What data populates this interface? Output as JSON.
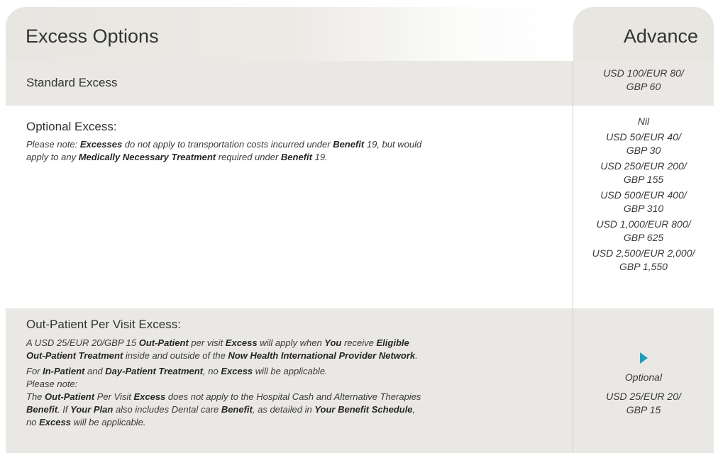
{
  "header": {
    "title": "Excess Options",
    "column_title": "Advance"
  },
  "standard_excess": {
    "label": "Standard Excess",
    "value_line1": "USD 100/EUR 80/",
    "value_line2": "GBP 60"
  },
  "optional_excess": {
    "label": "Optional Excess:",
    "note_line1": {
      "t1": "Please note: ",
      "b1": "Excesses",
      "t2": " do not apply to transportation costs incurred under ",
      "b2": "Benefit",
      "t3": " 19, but would"
    },
    "note_line2": {
      "t1": "apply to any ",
      "b1": "Medically Necessary Treatment",
      "t2": " required under ",
      "b2": "Benefit",
      "t3": " 19."
    },
    "options": [
      {
        "line1": "Nil",
        "line2": ""
      },
      {
        "line1": "USD 50/EUR 40/",
        "line2": "GBP 30"
      },
      {
        "line1": "USD 250/EUR 200/",
        "line2": "GBP 155"
      },
      {
        "line1": "USD 500/EUR 400/",
        "line2": "GBP 310"
      },
      {
        "line1": "USD 1,000/EUR 800/",
        "line2": "GBP 625"
      },
      {
        "line1": "USD 2,500/EUR 2,000/",
        "line2": "GBP 1,550"
      }
    ]
  },
  "outpatient_excess": {
    "label": "Out-Patient Per Visit Excess:",
    "p1_line1": {
      "t1": "A USD 25/EUR 20/GBP 15 ",
      "b1": "Out-Patient",
      "t2": " per visit ",
      "b2": "Excess",
      "t3": " will apply when ",
      "b3": "You",
      "t4": " receive ",
      "b4": "Eligible"
    },
    "p1_line2": {
      "b1": "Out-Patient Treatment",
      "t1": " inside and outside of the ",
      "b2": "Now Health International Provider Network",
      "t2": "."
    },
    "p2": {
      "t1": "For ",
      "b1": "In-Patient",
      "t2": " and ",
      "b2": "Day-Patient Treatment",
      "t3": ", no ",
      "b3": "Excess",
      "t4": " will be applicable."
    },
    "p3": "Please note:",
    "p4_line1": {
      "t1": "The ",
      "b1": "Out-Patient",
      "t2": " Per Visit ",
      "b2": "Excess",
      "t3": " does not apply to the Hospital Cash and Alternative Therapies"
    },
    "p4_line2": {
      "b1": "Benefit",
      "t1": ".  If ",
      "b2": "Your Plan",
      "t2": " also includes Dental care ",
      "b3": "Benefit",
      "t3": ", as detailed in ",
      "b4": "Your Benefit Schedule",
      "t4": ","
    },
    "p4_line3": {
      "t1": "no ",
      "b1": "Excess",
      "t2": " will be applicable."
    },
    "arrow_icon": "play-triangle-icon",
    "arrow_color": "#1d9fb8",
    "value_label": "Optional",
    "value_line1": "USD 25/EUR 20/",
    "value_line2": "GBP 15"
  },
  "colors": {
    "header_bg": "#e8e6e1",
    "row_shade": "#eae8e4",
    "text": "#333333"
  }
}
